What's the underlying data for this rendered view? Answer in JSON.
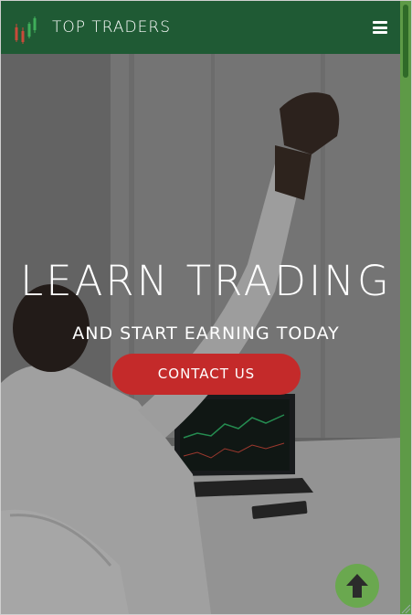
{
  "header": {
    "brand": "TOP TRADERS",
    "logo_icon": "candlestick-chart-icon",
    "menu_icon": "hamburger-menu-icon",
    "background_color": "#1f5a34"
  },
  "hero": {
    "title": "LEARN TRADING",
    "subtitle": "AND START EARNING TODAY",
    "cta_label": "CONTACT US",
    "cta_color": "#c42a2a"
  },
  "back_to_top": {
    "icon": "arrow-up-icon",
    "color": "#6aa84f"
  },
  "scrollbar": {
    "color": "#5e9a47",
    "thumb_color": "#2f6a28"
  }
}
